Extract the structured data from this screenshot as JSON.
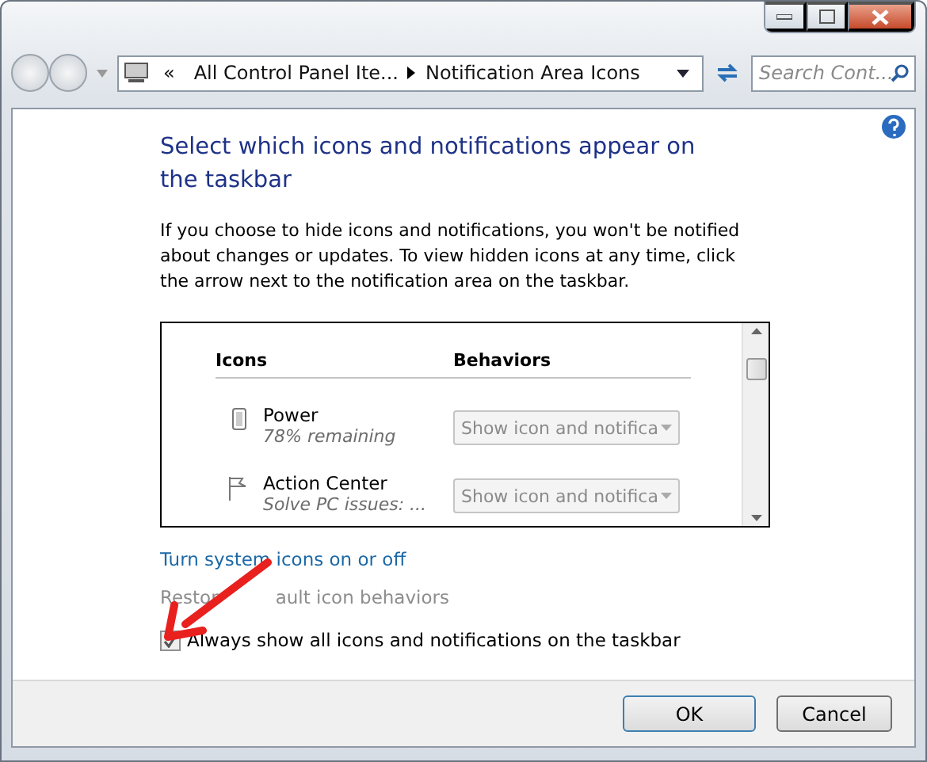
{
  "address_bar": {
    "overflow": "«",
    "crumbs": [
      "All Control Panel Ite...",
      "Notification Area Icons"
    ]
  },
  "search": {
    "placeholder": "Search Cont..."
  },
  "heading": "Select which icons and notifications appear on the taskbar",
  "description": "If you choose to hide icons and notifications, you won't be notified about changes or updates. To view hidden icons at any time, click the arrow next to the notification area on the taskbar.",
  "table": {
    "columns": [
      "Icons",
      "Behaviors"
    ],
    "rows": [
      {
        "kind": "battery",
        "name": "Power",
        "detail": "78% remaining",
        "behavior": "Show icon and notifica",
        "disabled": true
      },
      {
        "kind": "flag",
        "name": "Action Center",
        "detail": "Solve PC issues: ...",
        "behavior": "Show icon and notifica",
        "disabled": true
      }
    ]
  },
  "links": [
    {
      "label": "Turn system icons on or off",
      "disabled": false
    },
    {
      "label_parts": [
        "Restor",
        "ault icon behaviors"
      ],
      "disabled": true
    }
  ],
  "checkbox": {
    "label": "Always show all icons and notifications on the taskbar",
    "checked": true
  },
  "buttons": [
    {
      "label": "OK",
      "default": true
    },
    {
      "label": "Cancel",
      "default": false
    }
  ]
}
